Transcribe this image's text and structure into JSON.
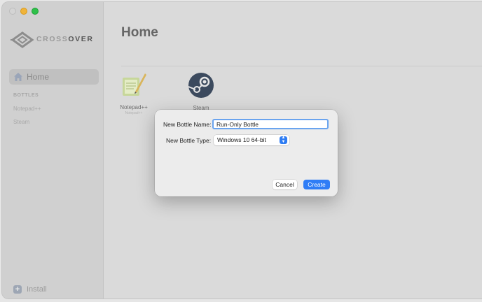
{
  "window": {
    "traffic_lights": [
      "close",
      "minimize",
      "maximize"
    ]
  },
  "sidebar": {
    "logo_text_prefix": "CROSS",
    "logo_text_suffix": "OVER",
    "home_label": "Home",
    "bottles_header": "BOTTLES",
    "bottles": [
      "Notepad++",
      "Steam"
    ],
    "install_label": "Install"
  },
  "main": {
    "title": "Home",
    "apps": [
      {
        "name": "Notepad++",
        "sub": "Notepad++",
        "icon": "notepad-plus-plus-icon"
      },
      {
        "name": "Steam",
        "icon": "steam-icon"
      }
    ]
  },
  "dialog": {
    "name_label": "New Bottle Name:",
    "name_value": "Run-Only Bottle",
    "type_label": "New Bottle Type:",
    "type_value": "Windows 10 64-bit",
    "cancel_label": "Cancel",
    "create_label": "Create"
  },
  "colors": {
    "accent": "#2f7df6",
    "focus_ring": "#6aa4ef",
    "traffic_min": "#f0b43a",
    "traffic_max": "#2fc04a"
  }
}
